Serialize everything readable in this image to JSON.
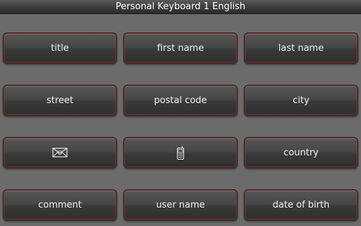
{
  "app": {
    "title": "Personal Keyboard 1 English"
  },
  "keys": {
    "title": "title",
    "first_name": "first name",
    "last_name": "last name",
    "street": "street",
    "postal_code": "postal code",
    "city": "city",
    "email_icon": "email-icon",
    "phone_icon": "mobile-phone-icon",
    "country": "country",
    "comment": "comment",
    "user_name": "user name",
    "date_of_birth": "date of birth"
  },
  "colors": {
    "background": "#6b6b6b",
    "key_border_accent": "#96372d",
    "text": "#f2f2f2"
  }
}
